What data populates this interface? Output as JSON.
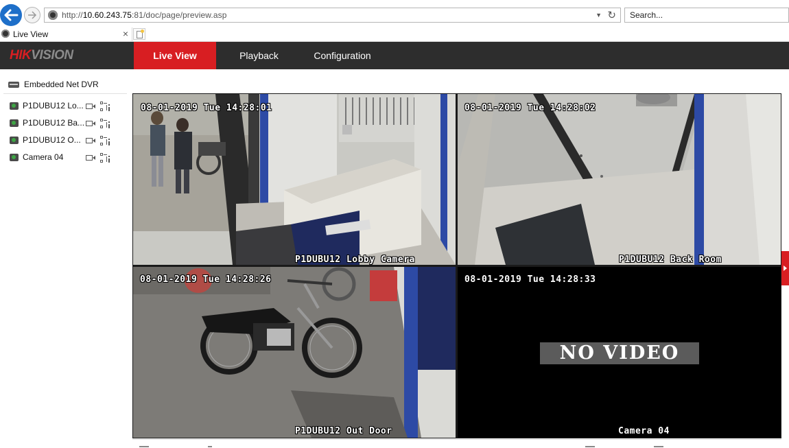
{
  "browser": {
    "url_prefix": "http://",
    "url_host": "10.60.243.75",
    "url_rest": ":81/doc/page/preview.asp",
    "search_placeholder": "Search...",
    "tab_title": "Live View"
  },
  "header": {
    "logo_left": "HIK",
    "logo_right": "VISION",
    "menu": [
      {
        "label": "Live View",
        "active": true
      },
      {
        "label": "Playback",
        "active": false
      },
      {
        "label": "Configuration",
        "active": false
      }
    ]
  },
  "sidebar": {
    "device": "Embedded Net DVR",
    "cameras": [
      {
        "label": "P1DUBU12 Lo..."
      },
      {
        "label": "P1DUBU12 Ba..."
      },
      {
        "label": "P1DUBU12 O..."
      },
      {
        "label": "Camera 04"
      }
    ]
  },
  "tiles": [
    {
      "timestamp": "08-01-2019 Tue 14:28:01",
      "name": "P1DUBU12 Lobby Camera"
    },
    {
      "timestamp": "08-01-2019 Tue 14:28:02",
      "name": "P1DUBU12 Back Room"
    },
    {
      "timestamp": "08-01-2019 Tue 14:28:26",
      "name": "P1DUBU12  Out Door"
    },
    {
      "timestamp": "08-01-2019 Tue 14:28:33",
      "name": "Camera 04",
      "status": "NO VIDEO"
    }
  ],
  "colors": {
    "accent": "#d81e22",
    "header_bg": "#2d2d2d",
    "selected_border": "#f0c233"
  }
}
